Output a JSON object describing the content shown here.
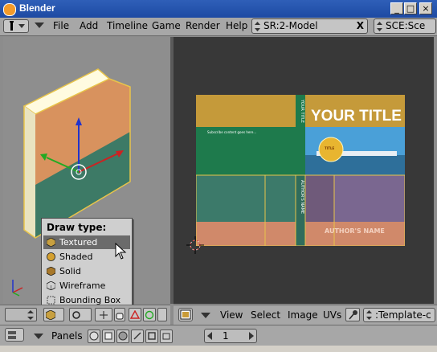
{
  "window": {
    "title": "Blender"
  },
  "titlebar_buttons": {
    "minimize": "_",
    "maximize": "□",
    "close": "×"
  },
  "menu": {
    "items": [
      "File",
      "Add",
      "Timeline",
      "Game",
      "Render",
      "Help"
    ]
  },
  "screen_field": {
    "value": "SR:2-Model",
    "close": "X"
  },
  "scene_field": {
    "value": "SCE:Sce"
  },
  "draw_type_menu": {
    "title": "Draw type:",
    "items": [
      "Textured",
      "Shaded",
      "Solid",
      "Wireframe",
      "Bounding Box"
    ],
    "selected": "Textured"
  },
  "image_editor_header": {
    "items": [
      "View",
      "Select",
      "Image",
      "UVs"
    ],
    "image_field": ":Template-c"
  },
  "buttons_window": {
    "panels_label": "Panels",
    "counter_value": "1"
  },
  "book_cover": {
    "title": "YOUR TITLE",
    "author": "AUTHOR'S NAME",
    "spine_title": "YOUR TITLE",
    "spine_author": "AUTHOR'S NAME",
    "back_text": "Subscribe content goes here...",
    "badge_text": "TITLE",
    "colors": {
      "gold": "#c59a3a",
      "green": "#1e7a4c",
      "teal": "#3c7a6a",
      "salmon": "#d0896a",
      "sky": "#4aa0d8"
    }
  },
  "colors": {
    "titlebar": "#1d4aa3",
    "panel": "#a7a7a7",
    "viewport3d": "#8e8e8e",
    "imageeditor": "#383838",
    "selection": "#6b6b6b"
  }
}
